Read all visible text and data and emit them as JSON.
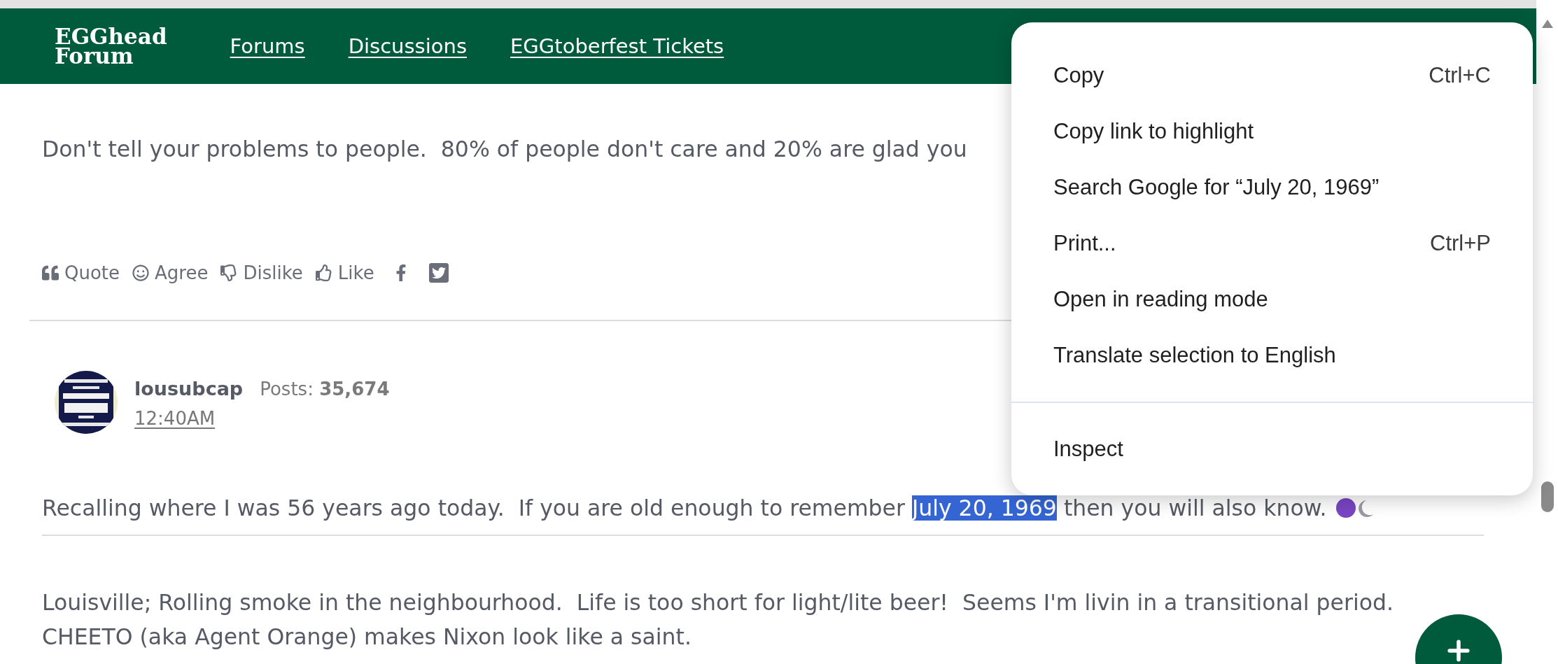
{
  "header": {
    "logo_lines": [
      "EGGhead",
      "Forum"
    ],
    "links": [
      "Forums",
      "Discussions",
      "EGGtoberfest Tickets"
    ]
  },
  "previous_post": {
    "signature": "Don't tell your problems to people.  80% of people don't care and 20% are glad you",
    "actions": [
      "Quote",
      "Agree",
      "Dislike",
      "Like"
    ]
  },
  "post": {
    "author": "lousubcap",
    "posts_label": "Posts:",
    "posts_count": "35,674",
    "time": "12:40AM",
    "body": {
      "before": "Recalling where I was 56 years ago today.  If you are old enough to remember ",
      "selected": "July 20, 1969",
      "after": " then you will also know."
    },
    "signature_lines": [
      "Louisville; Rolling smoke in the neighbourhood.  Life is too short for light/lite beer!  Seems I'm livin in a transitional period.",
      "CHEETO (aka Agent Orange) makes Nixon look like a saint."
    ]
  },
  "context_menu": {
    "groups": [
      [
        {
          "label": "Copy",
          "shortcut": "Ctrl+C"
        },
        {
          "label": "Copy link to highlight"
        },
        {
          "label": "Search Google for “July 20, 1969”"
        },
        {
          "label": "Print...",
          "shortcut": "Ctrl+P"
        },
        {
          "label": "Open in reading mode"
        },
        {
          "label": "Translate selection to English"
        }
      ],
      [
        {
          "label": "Inspect"
        }
      ]
    ]
  }
}
